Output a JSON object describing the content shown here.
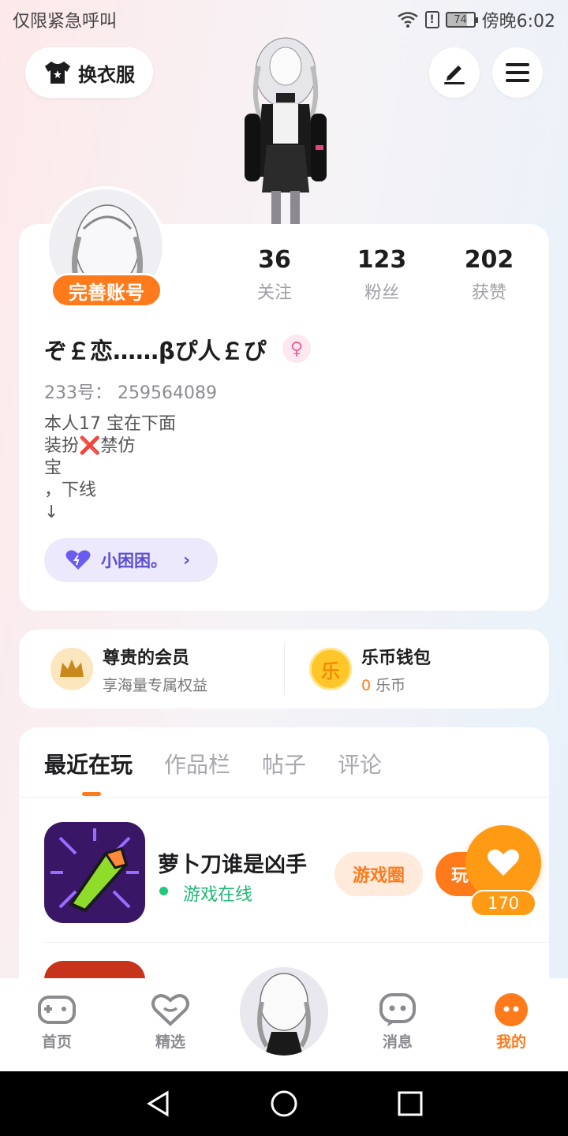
{
  "status_bar": {
    "carrier": "仅限紧急呼叫",
    "battery": "74",
    "time": "傍晚6:02"
  },
  "header": {
    "outfit_label": "换衣服"
  },
  "profile": {
    "complete_label": "完善账号",
    "stats": [
      {
        "value": "36",
        "label": "关注"
      },
      {
        "value": "123",
        "label": "粉丝"
      },
      {
        "value": "202",
        "label": "获赞"
      }
    ],
    "nickname": "ぞ￡恋……βぴ人￡ぴ",
    "gender_symbol": "♀",
    "uid": "233号： 259564089",
    "bio": "本人17 宝在下面\n装扮❌禁仿\n宝\n，下线\n↓",
    "status_chip": "小困困。"
  },
  "vip": {
    "member_title": "尊贵的会员",
    "member_sub": "享海量专属权益",
    "wallet_title": "乐币钱包",
    "wallet_amount": "0",
    "wallet_unit": "乐币",
    "coin_glyph": "乐"
  },
  "tabs": [
    "最近在玩",
    "作品栏",
    "帖子",
    "评论"
  ],
  "recent_game": {
    "name": "萝卜刀谁是凶手",
    "status": "游戏在线",
    "circle_label": "游戏圈",
    "play_label": "玩"
  },
  "like": {
    "count": "170"
  },
  "bottom_nav": [
    {
      "label": "首页",
      "icon": "gamepad-icon"
    },
    {
      "label": "精选",
      "icon": "heart-chat-icon"
    },
    {
      "label": "消息",
      "icon": "message-icon"
    },
    {
      "label": "我的",
      "icon": "profile-face-icon"
    }
  ],
  "colors": {
    "accent": "#ff7a1a",
    "online": "#21b874",
    "chip": "#5b4fd6"
  }
}
